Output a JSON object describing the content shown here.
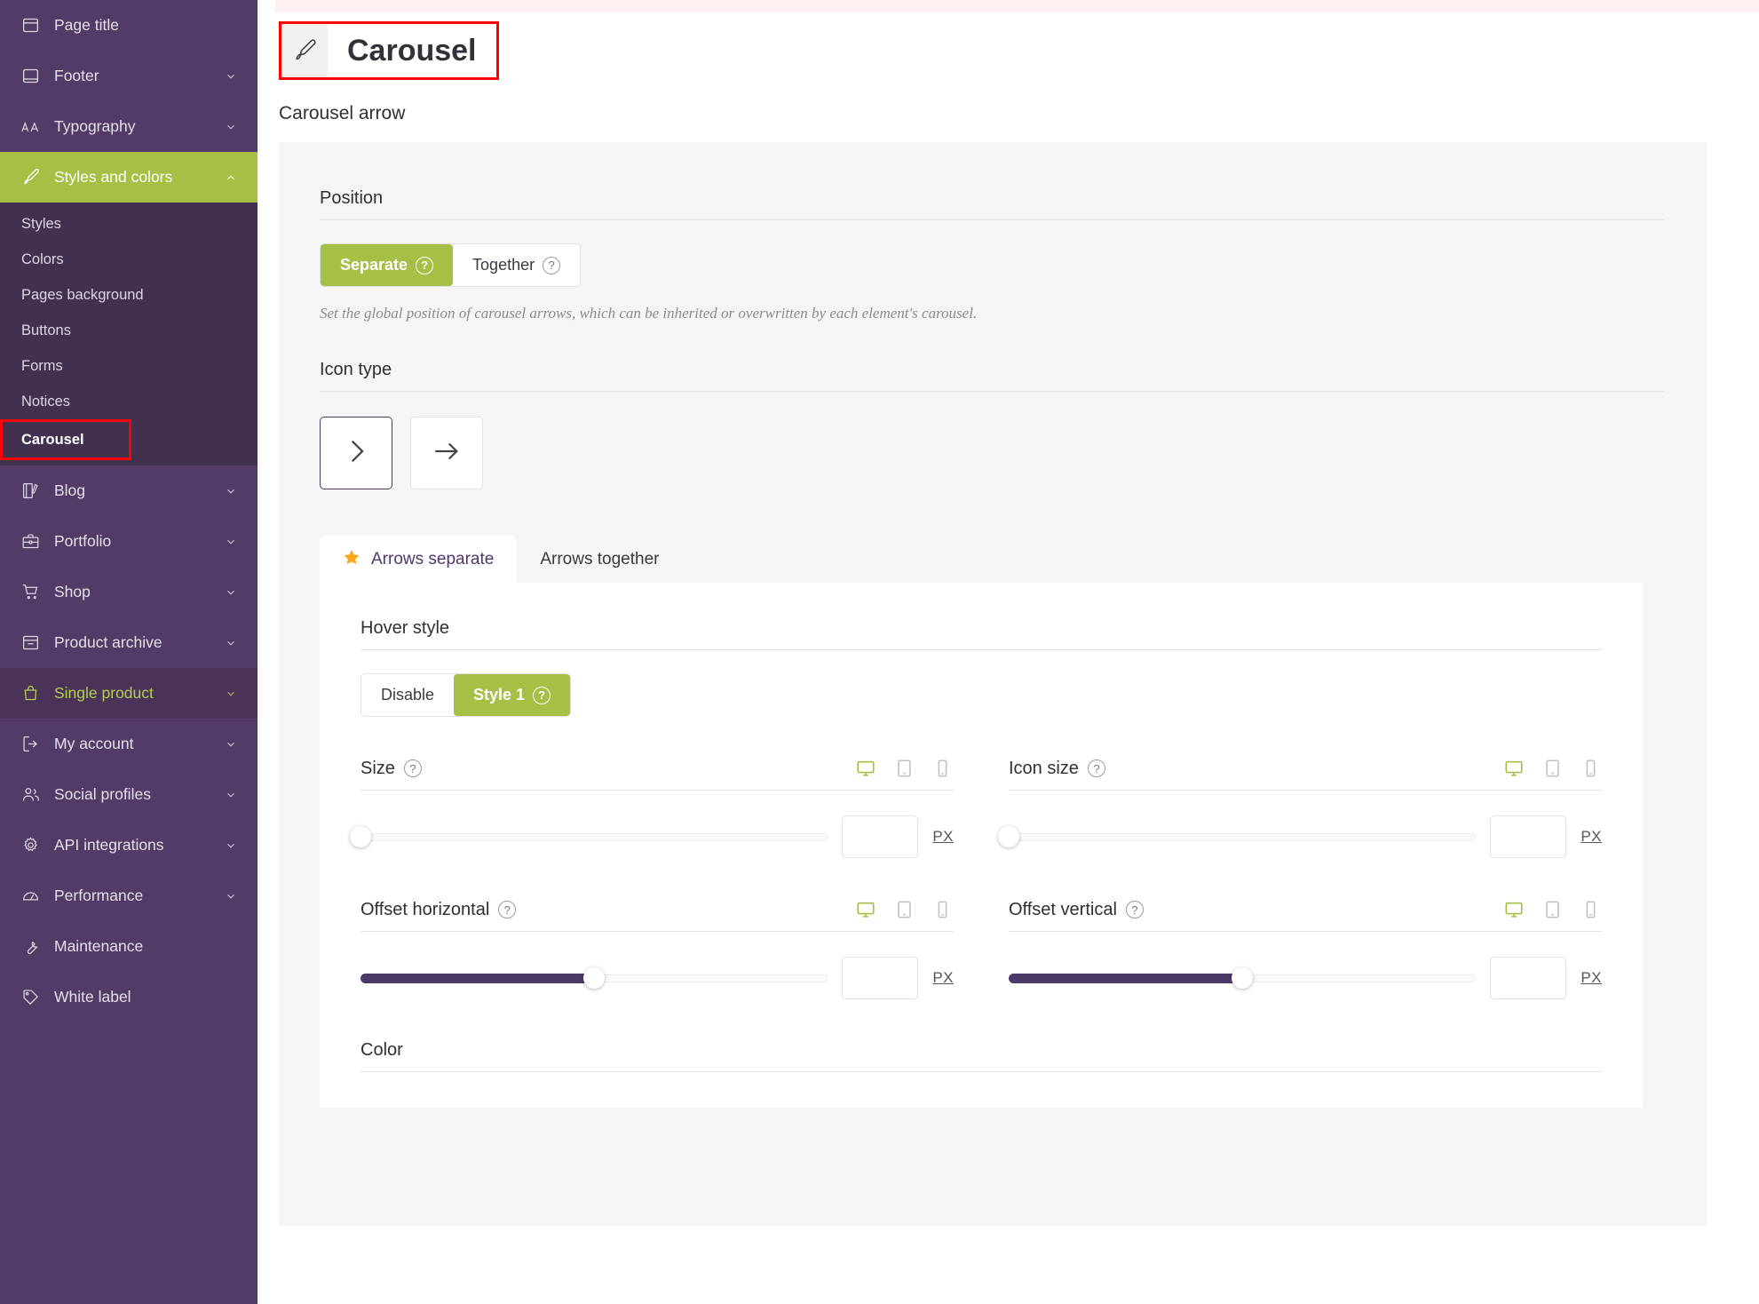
{
  "sidebar": {
    "items": [
      {
        "label": "Page title",
        "icon": "page-title-icon",
        "chevron": false,
        "state": "normal"
      },
      {
        "label": "Footer",
        "icon": "footer-icon",
        "chevron": true,
        "state": "normal"
      },
      {
        "label": "Typography",
        "icon": "typography-icon",
        "chevron": true,
        "state": "normal"
      },
      {
        "label": "Styles and colors",
        "icon": "brush-icon",
        "chevron": true,
        "state": "active"
      },
      {
        "label": "Blog",
        "icon": "blog-icon",
        "chevron": true,
        "state": "normal"
      },
      {
        "label": "Portfolio",
        "icon": "portfolio-icon",
        "chevron": true,
        "state": "normal"
      },
      {
        "label": "Shop",
        "icon": "cart-icon",
        "chevron": true,
        "state": "normal"
      },
      {
        "label": "Product archive",
        "icon": "archive-icon",
        "chevron": true,
        "state": "normal"
      },
      {
        "label": "Single product",
        "icon": "bag-icon",
        "chevron": true,
        "state": "hovered"
      },
      {
        "label": "My account",
        "icon": "login-icon",
        "chevron": true,
        "state": "normal"
      },
      {
        "label": "Social profiles",
        "icon": "users-icon",
        "chevron": true,
        "state": "normal"
      },
      {
        "label": "API integrations",
        "icon": "gear-icon",
        "chevron": true,
        "state": "normal"
      },
      {
        "label": "Performance",
        "icon": "gauge-icon",
        "chevron": true,
        "state": "normal"
      },
      {
        "label": "Maintenance",
        "icon": "wrench-icon",
        "chevron": false,
        "state": "normal"
      },
      {
        "label": "White label",
        "icon": "tag-icon",
        "chevron": false,
        "state": "normal"
      }
    ],
    "subitems": [
      {
        "label": "Styles",
        "current": false
      },
      {
        "label": "Colors",
        "current": false
      },
      {
        "label": "Pages background",
        "current": false
      },
      {
        "label": "Buttons",
        "current": false
      },
      {
        "label": "Forms",
        "current": false
      },
      {
        "label": "Notices",
        "current": false
      },
      {
        "label": "Carousel",
        "current": true
      }
    ]
  },
  "header": {
    "title": "Carousel",
    "icon": "brush-icon",
    "section_label": "Carousel arrow"
  },
  "position": {
    "label": "Position",
    "options": [
      {
        "label": "Separate",
        "selected": true,
        "help": "?"
      },
      {
        "label": "Together",
        "selected": false,
        "help": "?"
      }
    ],
    "helper_text": "Set the global position of carousel arrows, which can be inherited or overwritten by each element's carousel."
  },
  "icon_type": {
    "label": "Icon type",
    "options": [
      {
        "icon": "chevron-right-icon",
        "selected": true
      },
      {
        "icon": "arrow-right-icon",
        "selected": false
      }
    ]
  },
  "tabs": [
    {
      "label": "Arrows separate",
      "active": true,
      "icon": "star-icon"
    },
    {
      "label": "Arrows together",
      "active": false,
      "icon": null
    }
  ],
  "hover_style": {
    "label": "Hover style",
    "options": [
      {
        "label": "Disable",
        "selected": false,
        "help": null
      },
      {
        "label": "Style 1",
        "selected": true,
        "help": "?"
      }
    ]
  },
  "fields": [
    {
      "label": "Size",
      "help": "?",
      "devices": [
        {
          "name": "desktop-icon",
          "active": true
        },
        {
          "name": "tablet-icon",
          "active": false
        },
        {
          "name": "mobile-icon",
          "active": false
        }
      ],
      "slider_percent": 0,
      "value": "",
      "unit": "PX"
    },
    {
      "label": "Icon size",
      "help": "?",
      "devices": [
        {
          "name": "desktop-icon",
          "active": true
        },
        {
          "name": "tablet-icon",
          "active": false
        },
        {
          "name": "mobile-icon",
          "active": false
        }
      ],
      "slider_percent": 0,
      "value": "",
      "unit": "PX"
    },
    {
      "label": "Offset horizontal",
      "help": "?",
      "devices": [
        {
          "name": "desktop-icon",
          "active": true
        },
        {
          "name": "tablet-icon",
          "active": false
        },
        {
          "name": "mobile-icon",
          "active": false
        }
      ],
      "slider_percent": 50,
      "value": "",
      "unit": "PX"
    },
    {
      "label": "Offset vertical",
      "help": "?",
      "devices": [
        {
          "name": "desktop-icon",
          "active": true
        },
        {
          "name": "tablet-icon",
          "active": false
        },
        {
          "name": "mobile-icon",
          "active": false
        }
      ],
      "slider_percent": 50,
      "value": "",
      "unit": "PX"
    }
  ],
  "color_section": {
    "label": "Color"
  },
  "colors": {
    "sidebar_bg": "#533b67",
    "subnav_bg": "#42304f",
    "accent_green": "#a6bf45",
    "accent_purple": "#4b3a68",
    "highlight_red": "#ff0000",
    "panel_bg": "#f5f5f5",
    "star_orange": "#ffa91a"
  }
}
